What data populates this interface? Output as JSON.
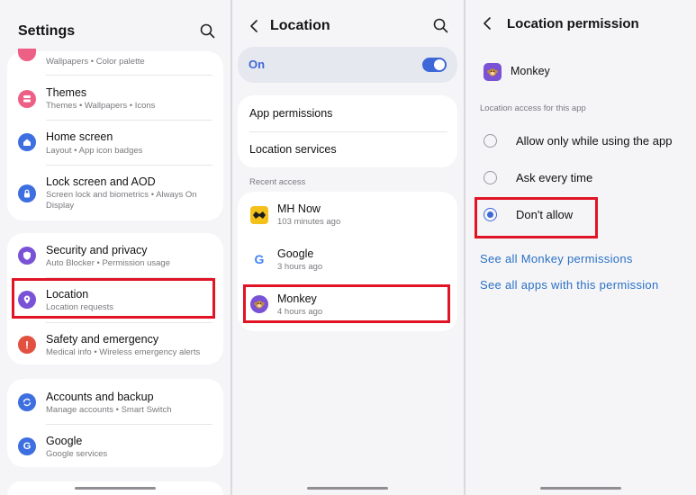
{
  "settings": {
    "title": "Settings",
    "partial_row_sub": "Wallpapers • Color palette",
    "rows": [
      {
        "title": "Themes",
        "sub": "Themes • Wallpapers • Icons"
      },
      {
        "title": "Home screen",
        "sub": "Layout • App icon badges"
      },
      {
        "title": "Lock screen and AOD",
        "sub": "Screen lock and biometrics • Always On Display"
      },
      {
        "title": "Security and privacy",
        "sub": "Auto Blocker • Permission usage"
      },
      {
        "title": "Location",
        "sub": "Location requests"
      },
      {
        "title": "Safety and emergency",
        "sub": "Medical info • Wireless emergency alerts"
      },
      {
        "title": "Accounts and backup",
        "sub": "Manage accounts • Smart Switch"
      },
      {
        "title": "Google",
        "sub": "Google services"
      }
    ]
  },
  "location": {
    "title": "Location",
    "toggle_label": "On",
    "toggle_on": true,
    "menu": [
      "App permissions",
      "Location services"
    ],
    "recent_header": "Recent access",
    "recent": [
      {
        "name": "MH Now",
        "time": "103 minutes ago"
      },
      {
        "name": "Google",
        "time": "3 hours ago"
      },
      {
        "name": "Monkey",
        "time": "4 hours ago"
      }
    ]
  },
  "permission": {
    "title": "Location permission",
    "app_name": "Monkey",
    "section_header": "Location access for this app",
    "options": [
      {
        "label": "Allow only while using the app",
        "selected": false
      },
      {
        "label": "Ask every time",
        "selected": false
      },
      {
        "label": "Don't allow",
        "selected": true
      }
    ],
    "links": [
      "See all Monkey permissions",
      "See all apps with this permission"
    ]
  },
  "colors": {
    "accent": "#3e68d8",
    "highlight": "#e01424",
    "link": "#2a70c4"
  }
}
